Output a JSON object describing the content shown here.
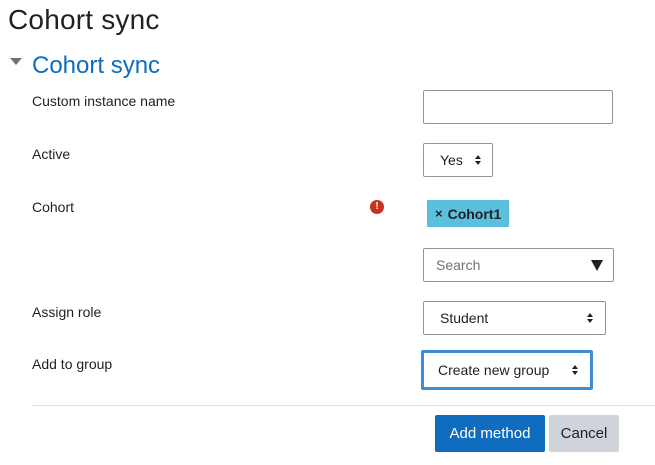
{
  "page": {
    "title": "Cohort sync"
  },
  "section": {
    "title": "Cohort sync"
  },
  "form": {
    "custom_instance_name": {
      "label": "Custom instance name",
      "value": ""
    },
    "active": {
      "label": "Active",
      "value": "Yes"
    },
    "cohort": {
      "label": "Cohort",
      "required_icon": "error-icon",
      "selected_tags": [
        "Cohort1"
      ],
      "remove_glyph": "×",
      "search_placeholder": "Search"
    },
    "assign_role": {
      "label": "Assign role",
      "value": "Student"
    },
    "add_to_group": {
      "label": "Add to group",
      "value": "Create new group"
    }
  },
  "buttons": {
    "add_method": "Add method",
    "cancel": "Cancel"
  },
  "colors": {
    "accent": "#0f6cbf",
    "tag_bg": "#5bc0de",
    "error": "#ca3120",
    "focus": "#3b8ed6",
    "secondary_button": "#ced4da"
  }
}
